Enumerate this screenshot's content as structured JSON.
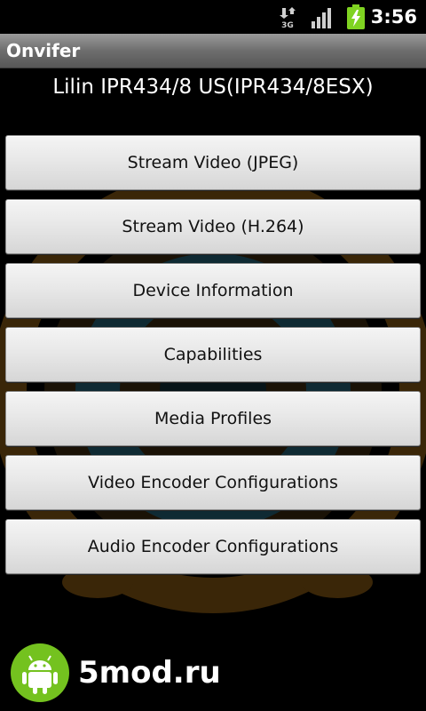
{
  "status_bar": {
    "network_label": "3G",
    "network_icon": "network-3g-icon",
    "signal_icon": "signal-strength-icon",
    "battery_icon": "battery-charging-icon",
    "time": "3:56"
  },
  "app": {
    "title": "Onvifer"
  },
  "device": {
    "name": "Lilin IPR434/8 US(IPR434/8ESX)"
  },
  "menu": {
    "buttons": [
      {
        "label": "Stream Video (JPEG)"
      },
      {
        "label": "Stream Video (H.264)"
      },
      {
        "label": "Device Information"
      },
      {
        "label": "Capabilities"
      },
      {
        "label": "Media Profiles"
      },
      {
        "label": "Video Encoder Configurations"
      },
      {
        "label": "Audio Encoder Configurations"
      }
    ]
  },
  "watermark": {
    "text": "5mod.ru",
    "icon": "android-robot-icon",
    "badge_color": "#74c21f"
  },
  "colors": {
    "battery_green": "#7fd321",
    "lens_orange": "#c27a16",
    "lens_blue": "#1f6f8c"
  }
}
